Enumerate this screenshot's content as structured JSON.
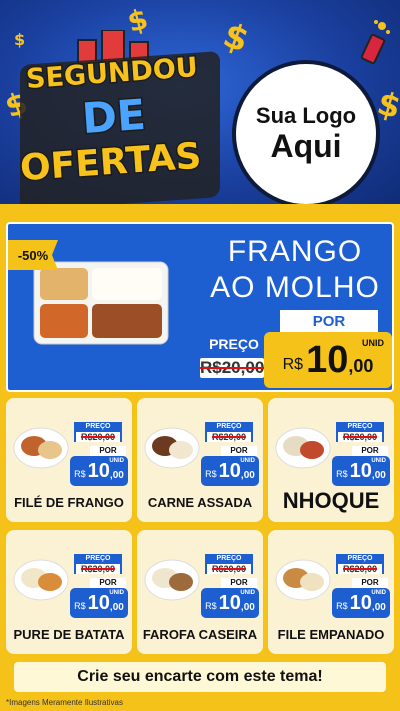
{
  "header": {
    "title_line1": "SEGUNDOU",
    "title_line2": "DE",
    "title_line3": "OFERTAS",
    "logo_line1": "Sua Logo",
    "logo_line2": "Aqui"
  },
  "featured": {
    "discount": "-50%",
    "name_line1": "FRANGO",
    "name_line2": "AO MOLHO",
    "por_label": "POR",
    "preco_label": "PREÇO",
    "old_price": "R$20,00",
    "currency": "R$",
    "price_int": "10",
    "price_dec": ",00",
    "unit": "UNID"
  },
  "products": [
    {
      "name": "FILÉ DE FRANGO",
      "preco_label": "PREÇO",
      "old_price": "R$20,00",
      "por_label": "POR",
      "currency": "R$",
      "price_int": "10",
      "price_dec": ",00",
      "unit": "UNID"
    },
    {
      "name": "CARNE ASSADA",
      "preco_label": "PREÇO",
      "old_price": "R$20,00",
      "por_label": "POR",
      "currency": "R$",
      "price_int": "10",
      "price_dec": ",00",
      "unit": "UNID"
    },
    {
      "name": "NHOQUE",
      "preco_label": "PREÇO",
      "old_price": "R$20,00",
      "por_label": "POR",
      "currency": "R$",
      "price_int": "10",
      "price_dec": ",00",
      "unit": "UNID"
    },
    {
      "name": "PURE DE BATATA",
      "preco_label": "PREÇO",
      "old_price": "R$20,00",
      "por_label": "POR",
      "currency": "R$",
      "price_int": "10",
      "price_dec": ",00",
      "unit": "UNID"
    },
    {
      "name": "FAROFA CASEIRA",
      "preco_label": "PREÇO",
      "old_price": "R$20,00",
      "por_label": "POR",
      "currency": "R$",
      "price_int": "10",
      "price_dec": ",00",
      "unit": "UNID"
    },
    {
      "name": "FILE EMPANADO",
      "preco_label": "PREÇO",
      "old_price": "R$20,00",
      "por_label": "POR",
      "currency": "R$",
      "price_int": "10",
      "price_dec": ",00",
      "unit": "UNID"
    }
  ],
  "cta": "Crie seu encarte com este tema!",
  "footnote": "*Imagens Meramente Ilustrativas",
  "colors": {
    "blue": "#1d5fd1",
    "yellow": "#f5c21a",
    "card": "#fbf1d3",
    "red": "#e23b3b"
  },
  "icons": {
    "dollar": "dollar-sign-icon",
    "firework": "firework-icon"
  }
}
